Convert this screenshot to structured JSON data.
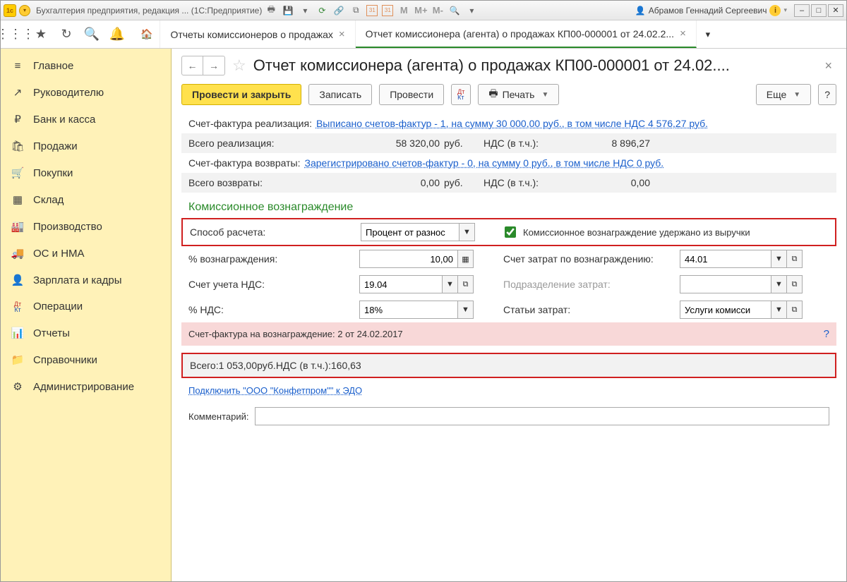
{
  "titlebar": {
    "app_title": "Бухгалтерия предприятия, редакция ...  (1С:Предприятие)",
    "user_name": "Абрамов Геннадий Сергеевич",
    "cal1": "31",
    "cal2": "31",
    "m": "M",
    "mp": "M+",
    "mm": "M-"
  },
  "tabs": [
    {
      "label": "Отчеты комиссионеров о продажах"
    },
    {
      "label": "Отчет комиссионера (агента) о продажах КП00-000001 от 24.02.2..."
    }
  ],
  "sidebar": {
    "items": [
      {
        "icon": "≡",
        "label": "Главное"
      },
      {
        "icon": "↗",
        "label": "Руководителю"
      },
      {
        "icon": "₽",
        "label": "Банк и касса"
      },
      {
        "icon": "🛍",
        "label": "Продажи"
      },
      {
        "icon": "🛒",
        "label": "Покупки"
      },
      {
        "icon": "▦",
        "label": "Склад"
      },
      {
        "icon": "🏭",
        "label": "Производство"
      },
      {
        "icon": "🚚",
        "label": "ОС и НМА"
      },
      {
        "icon": "👤",
        "label": "Зарплата и кадры"
      },
      {
        "icon": "dtkt",
        "label": "Операции"
      },
      {
        "icon": "📊",
        "label": "Отчеты"
      },
      {
        "icon": "📁",
        "label": "Справочники"
      },
      {
        "icon": "⚙",
        "label": "Администрирование"
      }
    ]
  },
  "page": {
    "title": "Отчет комиссионера (агента) о продажах КП00-000001 от 24.02....",
    "toolbar": {
      "save_close": "Провести и закрыть",
      "write": "Записать",
      "post": "Провести",
      "print": "Печать",
      "more": "Еще"
    },
    "invoice_sale_label": "Счет-фактура реализация:",
    "invoice_sale_link": "Выписано счетов-фактур - 1, на сумму 30 000,00 руб., в том числе НДС 4 576,27 руб.",
    "total_sale_label": "Всего реализация:",
    "total_sale_value": "58 320,00",
    "rub": "руб.",
    "vat_incl": "НДС (в т.ч.):",
    "total_sale_vat": "8 896,27",
    "invoice_ret_label": "Счет-фактура возвраты:",
    "invoice_ret_link": "Зарегистрировано счетов-фактур - 0, на сумму 0 руб., в том числе НДС 0 руб.",
    "total_ret_label": "Всего возвраты:",
    "total_ret_value": "0,00",
    "total_ret_vat": "0,00",
    "commission_title": "Комиссионное вознаграждение",
    "calc_method_label": "Способ расчета:",
    "calc_method_value": "Процент от разнос",
    "chk_label": "Комиссионное вознаграждение удержано из выручки",
    "pct_label": "% вознаграждения:",
    "pct_value": "10,00",
    "cost_acc_label": "Счет затрат по вознаграждению:",
    "cost_acc_value": "44.01",
    "vat_acc_label": "Счет учета НДС:",
    "vat_acc_value": "19.04",
    "dept_label": "Подразделение затрат:",
    "dept_value": "",
    "vat_pct_label": "% НДС:",
    "vat_pct_value": "18%",
    "cost_item_label": "Статьи затрат:",
    "cost_item_value": "Услуги комисси",
    "commission_invoice_label": "Счет-фактура на вознаграждение:",
    "commission_invoice_link": "2 от 24.02.2017",
    "total_label": "Всего:",
    "total_value": "1 053,00",
    "total_vat": "160,63",
    "edo_link": "Подключить \"ООО \"Конфетпром\"\" к ЭДО",
    "comment_label": "Комментарий:",
    "comment_value": ""
  }
}
